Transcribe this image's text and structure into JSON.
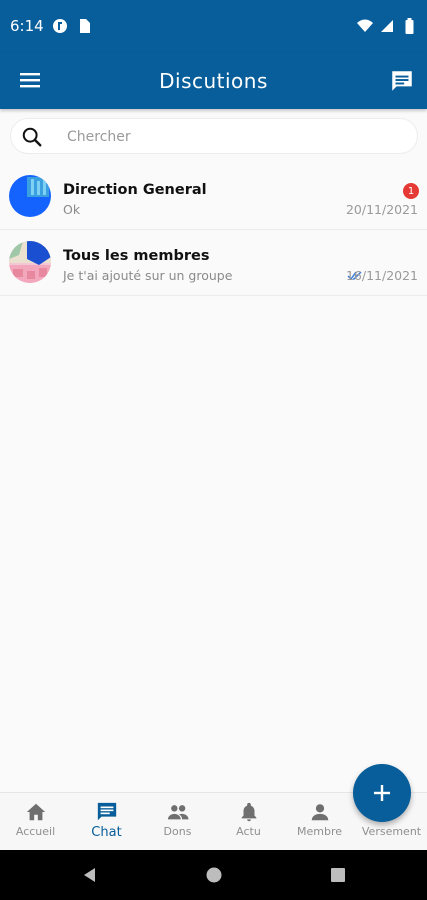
{
  "status_bar": {
    "time": "6:14"
  },
  "app_bar": {
    "title": "Discutions"
  },
  "search": {
    "placeholder": "Chercher"
  },
  "chats": [
    {
      "name": "Direction General",
      "preview": "Ok",
      "date": "20/11/2021",
      "unread": "1",
      "avatar_icon": "group-avatar-blue"
    },
    {
      "name": "Tous les membres",
      "preview": "Je t'ai ajouté sur un groupe",
      "date": "16/11/2021",
      "read_status_icon": "double-check-icon",
      "avatar_icon": "group-avatar-photo"
    }
  ],
  "fab": {
    "icon": "plus-icon"
  },
  "bottom_nav": [
    {
      "label": "Accueil",
      "icon": "home-icon",
      "active": false
    },
    {
      "label": "Chat",
      "icon": "chat-icon",
      "active": true
    },
    {
      "label": "Dons",
      "icon": "people-icon",
      "active": false
    },
    {
      "label": "Actu",
      "icon": "bell-icon",
      "active": false
    },
    {
      "label": "Membre",
      "icon": "person-icon",
      "active": false
    },
    {
      "label": "Versement",
      "icon": "payment-icon",
      "active": false
    }
  ],
  "colors": {
    "primary": "#075e9a",
    "badge": "#e53935",
    "text_muted": "#8a8a8a"
  }
}
